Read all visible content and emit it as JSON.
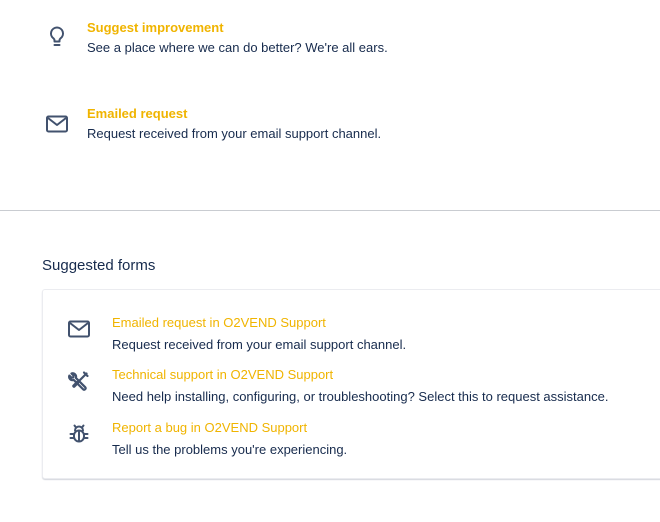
{
  "request_types": [
    {
      "title": "Suggest improvement",
      "description": "See a place where we can do better? We're all ears.",
      "icon": "lightbulb-icon"
    },
    {
      "title": "Emailed request",
      "description": "Request received from your email support channel.",
      "icon": "envelope-icon"
    }
  ],
  "suggested_forms": {
    "heading": "Suggested forms",
    "items": [
      {
        "title": "Emailed request in O2VEND Support",
        "description": "Request received from your email support channel.",
        "icon": "envelope-icon"
      },
      {
        "title": "Technical support in O2VEND Support",
        "description": "Need help installing, configuring, or troubleshooting? Select this to request assistance.",
        "icon": "wrench-screwdriver-icon"
      },
      {
        "title": "Report a bug in O2VEND Support",
        "description": "Tell us the problems you're experiencing.",
        "icon": "bug-icon"
      }
    ]
  },
  "colors": {
    "link": "#f0b400",
    "text": "#172b4d",
    "icon": "#42526e",
    "divider": "#c9ccd1"
  }
}
